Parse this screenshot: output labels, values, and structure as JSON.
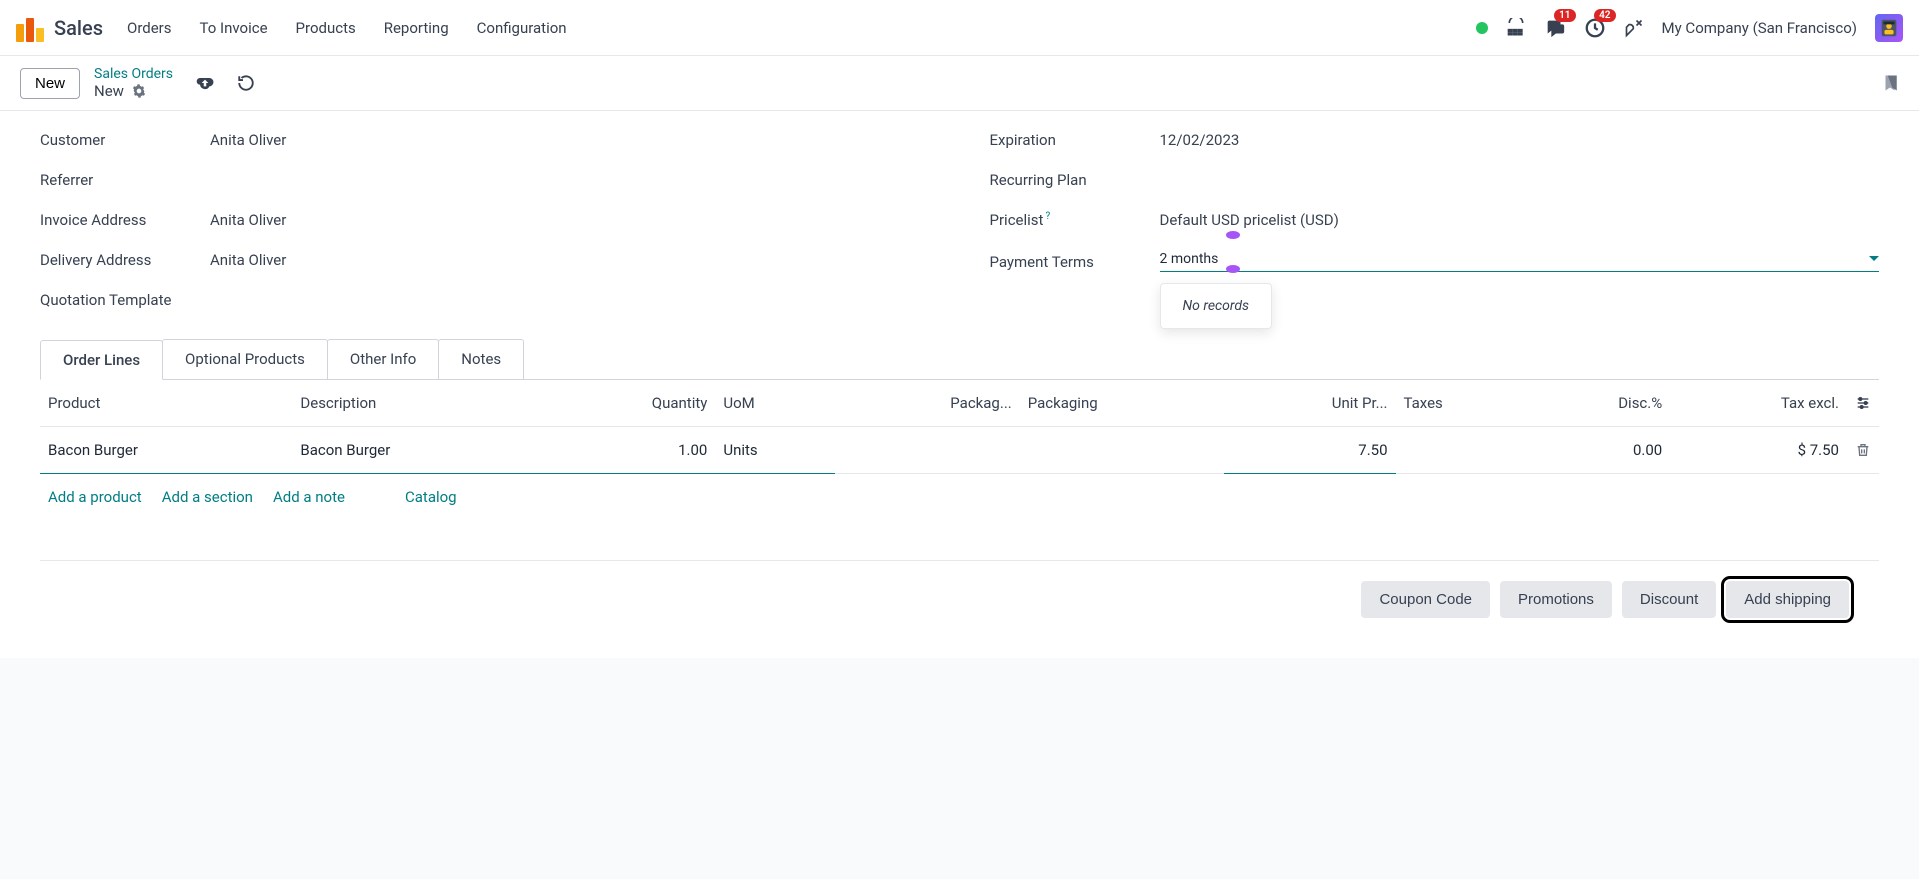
{
  "topbar": {
    "app_name": "Sales",
    "nav": [
      "Orders",
      "To Invoice",
      "Products",
      "Reporting",
      "Configuration"
    ],
    "badges": {
      "messages": "11",
      "activities": "42"
    },
    "company": "My Company (San Francisco)"
  },
  "subhead": {
    "new_btn": "New",
    "breadcrumb_link": "Sales Orders",
    "breadcrumb_current": "New"
  },
  "form": {
    "left": {
      "customer": {
        "label": "Customer",
        "value": "Anita Oliver"
      },
      "referrer": {
        "label": "Referrer",
        "value": ""
      },
      "invoice_address": {
        "label": "Invoice Address",
        "value": "Anita Oliver"
      },
      "delivery_address": {
        "label": "Delivery Address",
        "value": "Anita Oliver"
      },
      "quotation_template": {
        "label": "Quotation Template",
        "value": ""
      }
    },
    "right": {
      "expiration": {
        "label": "Expiration",
        "value": "12/02/2023"
      },
      "recurring_plan": {
        "label": "Recurring Plan",
        "value": ""
      },
      "pricelist": {
        "label": "Pricelist",
        "value": "Default USD pricelist (USD)"
      },
      "payment_terms": {
        "label": "Payment Terms",
        "value": "2 months",
        "dropdown_text": "No records"
      }
    }
  },
  "tabs": [
    "Order Lines",
    "Optional Products",
    "Other Info",
    "Notes"
  ],
  "table": {
    "headers": {
      "product": "Product",
      "description": "Description",
      "quantity": "Quantity",
      "uom": "UoM",
      "packag": "Packag...",
      "packaging": "Packaging",
      "unit_price": "Unit Pr...",
      "taxes": "Taxes",
      "disc": "Disc.%",
      "tax_excl": "Tax excl."
    },
    "rows": [
      {
        "product": "Bacon Burger",
        "description": "Bacon Burger",
        "quantity": "1.00",
        "uom": "Units",
        "packag": "",
        "packaging": "",
        "unit_price": "7.50",
        "taxes": "",
        "disc": "0.00",
        "tax_excl": "$ 7.50"
      }
    ],
    "add": {
      "product": "Add a product",
      "section": "Add a section",
      "note": "Add a note",
      "catalog": "Catalog"
    }
  },
  "footer": {
    "coupon": "Coupon Code",
    "promotions": "Promotions",
    "discount": "Discount",
    "shipping": "Add shipping"
  }
}
